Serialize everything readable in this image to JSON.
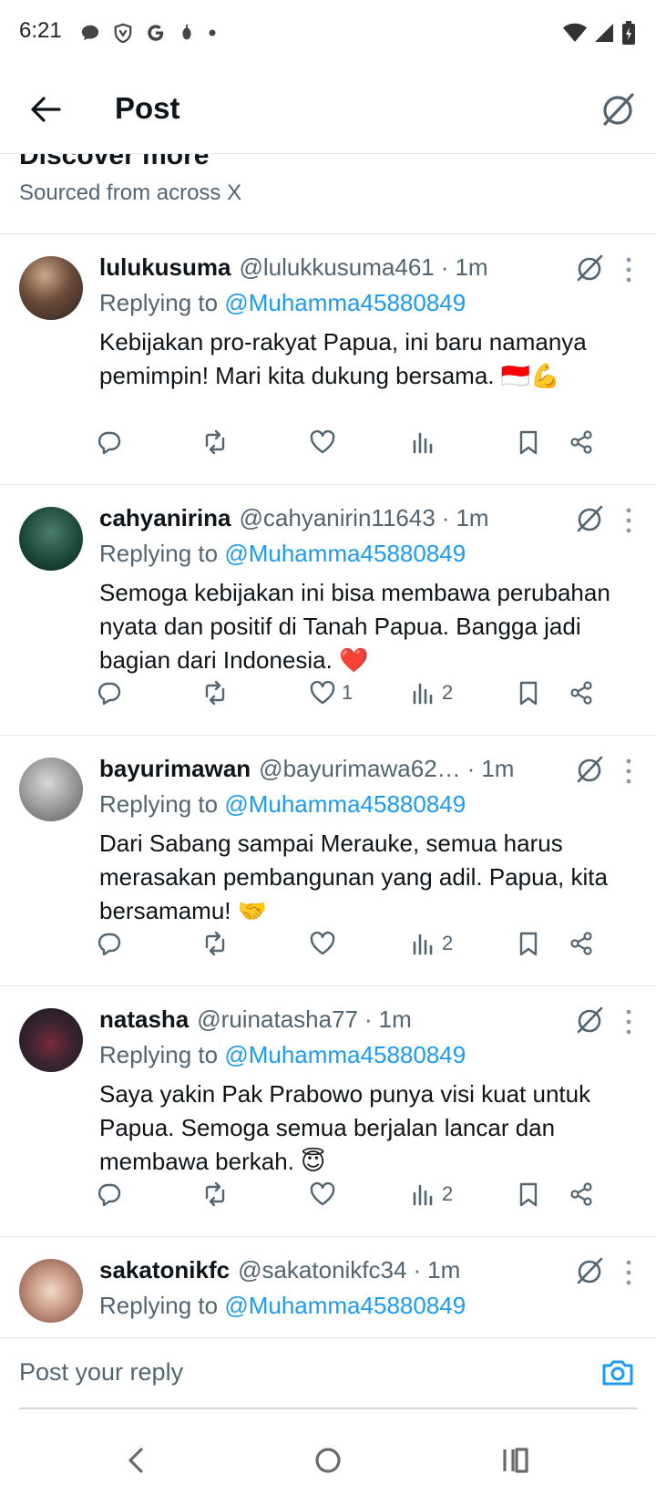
{
  "status": {
    "time": "6:21"
  },
  "header": {
    "title": "Post"
  },
  "discover": {
    "title": "Discover more",
    "subtitle": "Sourced from across X"
  },
  "replies": [
    {
      "name": "lulukusuma",
      "handle": "@lulukkusuma461",
      "time": "1m",
      "replying_label": "Replying to",
      "mention": "@Muhamma45880849",
      "text": "Kebijakan pro-rakyat Papua, ini baru namanya pemimpin! Mari kita dukung bersama. 🇮🇩💪",
      "likes": "",
      "views": ""
    },
    {
      "name": "cahyanirina",
      "handle": "@cahyanirin11643",
      "time": "1m",
      "replying_label": "Replying to",
      "mention": "@Muhamma45880849",
      "text": "Semoga kebijakan ini bisa membawa perubahan nyata dan positif di Tanah Papua. Bangga jadi bagian dari Indonesia. ❤️",
      "likes": "1",
      "views": "2"
    },
    {
      "name": "bayurimawan",
      "handle": "@bayurimawa62…",
      "time": "1m",
      "replying_label": "Replying to",
      "mention": "@Muhamma45880849",
      "text": "Dari Sabang sampai Merauke, semua harus merasakan pembangunan yang adil. Papua, kita bersamamu! 🤝",
      "likes": "",
      "views": "2"
    },
    {
      "name": "natasha",
      "handle": "@ruinatasha77",
      "time": "1m",
      "replying_label": "Replying to",
      "mention": "@Muhamma45880849",
      "text": "Saya yakin Pak Prabowo punya visi kuat untuk Papua. Semoga semua berjalan lancar dan membawa berkah. 😇",
      "likes": "",
      "views": "2"
    },
    {
      "name": "sakatonikfc",
      "handle": "@sakatonikfc34",
      "time": "1m",
      "replying_label": "Replying to",
      "mention": "@Muhamma45880849",
      "text": "",
      "likes": "",
      "views": ""
    }
  ],
  "composer": {
    "placeholder": "Post your reply"
  },
  "colors": {
    "accent": "#1d9bf0",
    "secondary_text": "#536471",
    "divider": "#e6e9ec",
    "heart_red": "#e0245e"
  }
}
